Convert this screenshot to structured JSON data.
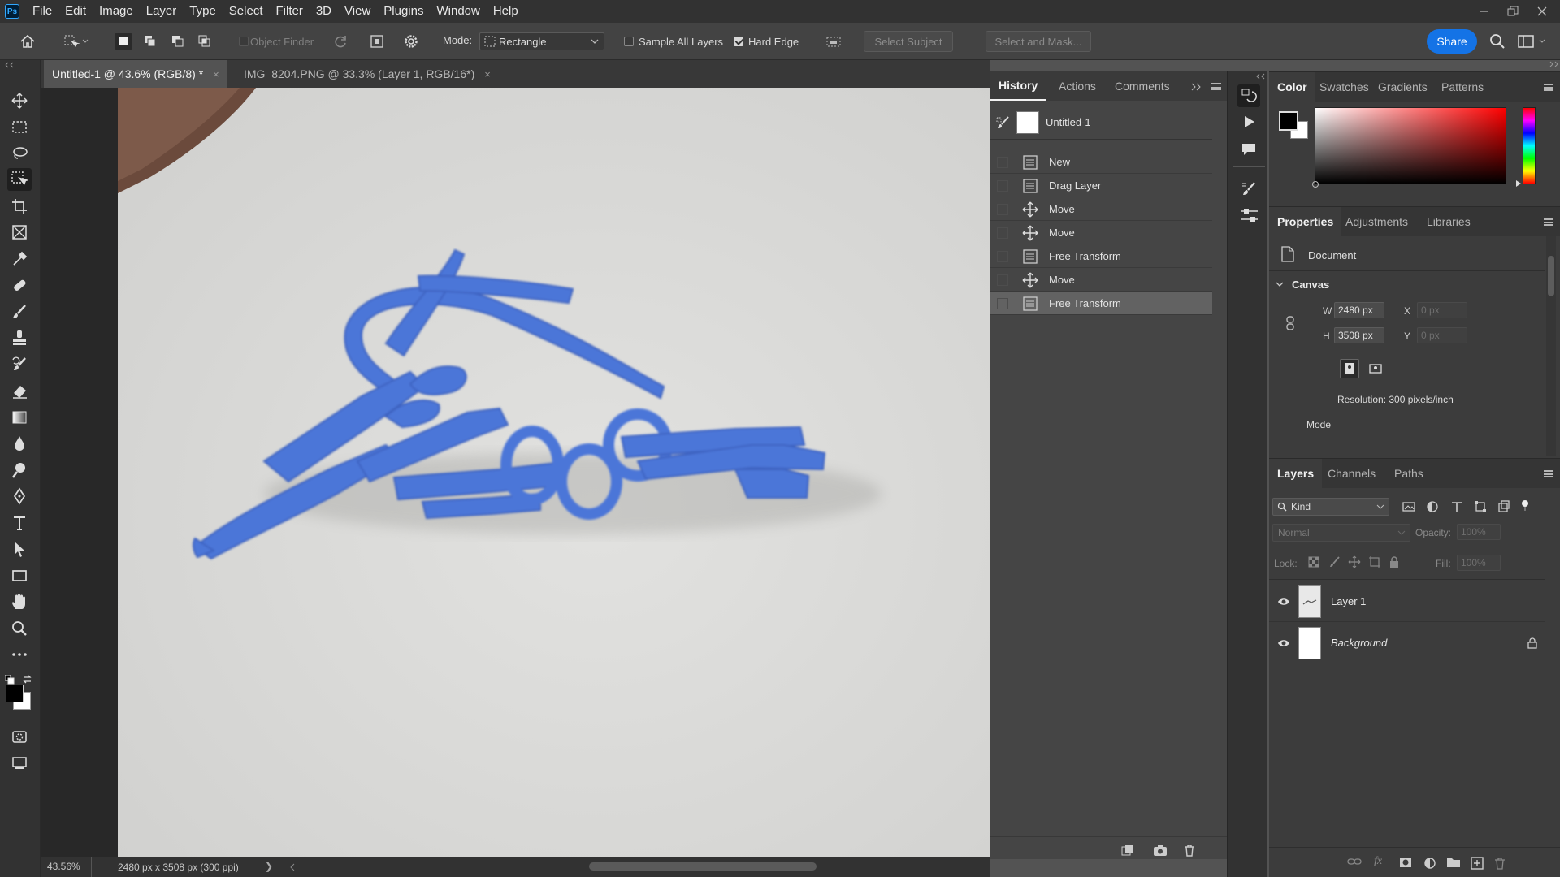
{
  "menubar": {
    "items": [
      "File",
      "Edit",
      "Image",
      "Layer",
      "Type",
      "Select",
      "Filter",
      "3D",
      "View",
      "Plugins",
      "Window",
      "Help"
    ],
    "logo": "Ps"
  },
  "options": {
    "object_finder": "Object Finder",
    "mode_label": "Mode:",
    "mode_value": "Rectangle",
    "sample_all_layers": "Sample All Layers",
    "sample_all_layers_checked": false,
    "hard_edge": "Hard Edge",
    "hard_edge_checked": true,
    "select_subject": "Select Subject",
    "select_and_mask": "Select and Mask...",
    "share": "Share"
  },
  "doc_tabs": [
    {
      "label": "Untitled-1 @ 43.6% (RGB/8) *",
      "close": "×"
    },
    {
      "label": "IMG_8204.PNG @ 33.3% (Layer 1, RGB/16*)",
      "close": "×"
    }
  ],
  "status": {
    "zoom": "43.56%",
    "doc_info": "2480 px x 3508 px (300 ppi)",
    "arrow": "❯"
  },
  "history_panel": {
    "tabs": [
      "History",
      "Actions",
      "Comments"
    ],
    "snapshot_label": "Untitled-1",
    "states": [
      {
        "label": "New",
        "icon": "document-icon"
      },
      {
        "label": "Drag Layer",
        "icon": "document-icon"
      },
      {
        "label": "Move",
        "icon": "move-icon"
      },
      {
        "label": "Move",
        "icon": "move-icon"
      },
      {
        "label": "Free Transform",
        "icon": "document-icon"
      },
      {
        "label": "Move",
        "icon": "move-icon"
      },
      {
        "label": "Free Transform",
        "icon": "document-icon"
      }
    ]
  },
  "color_panel": {
    "tabs": [
      "Color",
      "Swatches",
      "Gradients",
      "Patterns"
    ],
    "foreground": "#000000",
    "background": "#ffffff",
    "hue_base": "#ff0000"
  },
  "properties_panel": {
    "tabs": [
      "Properties",
      "Adjustments",
      "Libraries"
    ],
    "doc_label": "Document",
    "canvas_label": "Canvas",
    "w_label": "W",
    "w_value": "2480 px",
    "h_label": "H",
    "h_value": "3508 px",
    "x_label": "X",
    "x_value": "0 px",
    "y_label": "Y",
    "y_value": "0 px",
    "resolution": "Resolution: 300 pixels/inch",
    "mode_label": "Mode"
  },
  "layers_panel": {
    "tabs": [
      "Layers",
      "Channels",
      "Paths"
    ],
    "filter_kind": "Kind",
    "blend_mode": "Normal",
    "opacity_label": "Opacity:",
    "opacity_value": "100%",
    "lock_label": "Lock:",
    "fill_label": "Fill:",
    "fill_value": "100%",
    "layers": [
      {
        "name": "Layer 1",
        "visible": true,
        "locked": false
      },
      {
        "name": "Background",
        "visible": true,
        "locked": true
      }
    ]
  },
  "colors": {
    "accent": "#1473e6",
    "selection_overlay": "#4a74d6"
  }
}
